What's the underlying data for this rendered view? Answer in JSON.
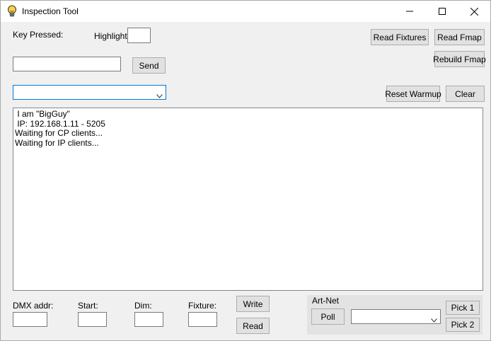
{
  "window": {
    "title": "Inspection Tool"
  },
  "icons": {
    "app": "lightbulb-icon",
    "minimize": "minimize-icon",
    "maximize": "maximize-icon",
    "close": "close-icon",
    "dropdown": "chevron-down-icon"
  },
  "top": {
    "key_pressed_label": "Key Pressed:",
    "highlight_label": "Highlight:",
    "highlight_value": "",
    "send_input_value": "",
    "send_label": "Send",
    "dropdown_value": ""
  },
  "buttons": {
    "read_fixtures": "Read Fixtures",
    "read_fmap": "Read Fmap",
    "rebuild_fmap": "Rebuild Fmap",
    "reset_warmup": "Reset Warmup",
    "clear": "Clear"
  },
  "console": {
    "lines": [
      " I am \"BigGuy\"",
      " IP: 192.168.1.11 - 5205",
      "Waiting for CP clients...",
      "Waiting for IP clients..."
    ]
  },
  "bottom": {
    "dmx_addr_label": "DMX addr:",
    "start_label": "Start:",
    "dim_label": "Dim:",
    "fixture_label": "Fixture:",
    "dmx_addr_value": "",
    "start_value": "",
    "dim_value": "",
    "fixture_value": "",
    "write_label": "Write",
    "read_label": "Read"
  },
  "artnet": {
    "group_label": "Art-Net",
    "poll_label": "Poll",
    "select_value": "",
    "pick1_label": "Pick 1",
    "pick2_label": "Pick 2"
  },
  "colors": {
    "focus_border": "#0078d7",
    "bulb": "#f7d046"
  }
}
